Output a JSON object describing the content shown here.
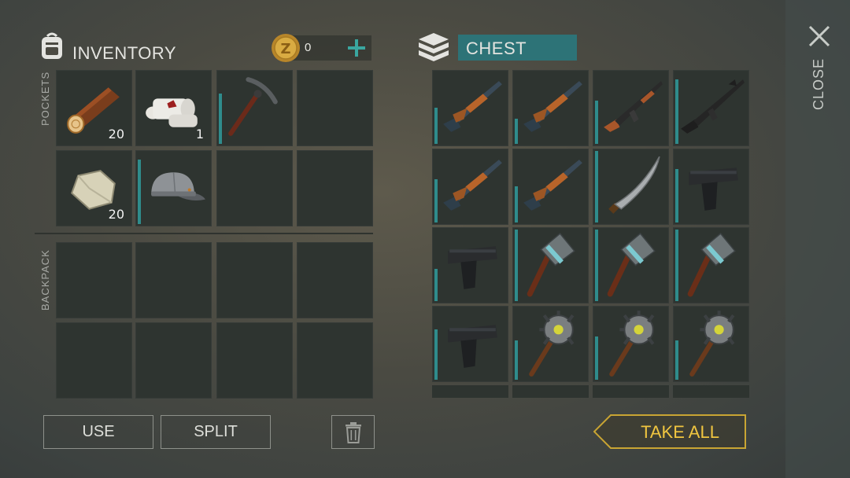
{
  "inventory": {
    "title": "INVENTORY",
    "coins": "0",
    "pockets_label": "POCKETS",
    "backpack_label": "BACKPACK",
    "pockets": [
      {
        "icon": "log-icon",
        "count": "20"
      },
      {
        "icon": "bandage-icon",
        "count": "1"
      },
      {
        "icon": "pickaxe-icon",
        "durability": 0.7
      },
      {
        "icon": "empty"
      },
      {
        "icon": "stone-icon",
        "count": "20"
      },
      {
        "icon": "cap-icon",
        "durability": 0.9
      },
      {
        "icon": "empty"
      },
      {
        "icon": "empty"
      }
    ],
    "backpack_slots": 8
  },
  "chest": {
    "title": "CHEST",
    "items": [
      {
        "icon": "shotgun-icon",
        "durability": 0.5
      },
      {
        "icon": "shotgun-icon",
        "durability": 0.35
      },
      {
        "icon": "assault-rifle-icon",
        "durability": 0.6
      },
      {
        "icon": "m16-rifle-icon",
        "durability": 0.9
      },
      {
        "icon": "shotgun-icon",
        "durability": 0.6
      },
      {
        "icon": "shotgun-icon",
        "durability": 0.5
      },
      {
        "icon": "machete-icon",
        "durability": 1.0
      },
      {
        "icon": "pistol-icon",
        "durability": 0.75
      },
      {
        "icon": "pistol-icon",
        "durability": 0.45
      },
      {
        "icon": "sledgehammer-icon",
        "durability": 1.0
      },
      {
        "icon": "sledgehammer-icon",
        "durability": 1.0
      },
      {
        "icon": "sledgehammer-icon",
        "durability": 1.0
      },
      {
        "icon": "pistol-icon",
        "durability": 0.7
      },
      {
        "icon": "spiked-mace-icon",
        "durability": 0.55
      },
      {
        "icon": "spiked-mace-icon",
        "durability": 0.6
      },
      {
        "icon": "spiked-mace-icon",
        "durability": 0.55
      }
    ]
  },
  "buttons": {
    "use": "USE",
    "split": "SPLIT",
    "take_all": "TAKE ALL",
    "close": "CLOSE"
  },
  "colors": {
    "accent_teal": "#2f7f80",
    "chest_title_bg": "#2d7377",
    "take_all_border": "#c9a533",
    "take_all_text": "#f0c540",
    "coin": "#d4a63a"
  }
}
